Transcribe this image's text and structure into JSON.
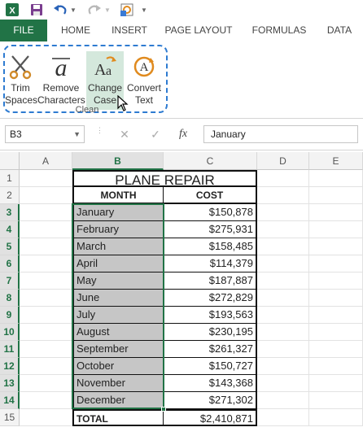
{
  "tabs": [
    {
      "label": "FILE",
      "active": true
    },
    {
      "label": "HOME"
    },
    {
      "label": "INSERT"
    },
    {
      "label": "PAGE LAYOUT"
    },
    {
      "label": "FORMULAS"
    },
    {
      "label": "DATA"
    }
  ],
  "ribbon": {
    "buttons": [
      {
        "line1": "Trim",
        "line2": "Spaces",
        "icon": "scissors-icon"
      },
      {
        "line1": "Remove",
        "line2": "Characters",
        "icon": "remove-characters-icon"
      },
      {
        "line1": "Change",
        "line2": "Case",
        "icon": "change-case-icon",
        "active": true
      },
      {
        "line1": "Convert",
        "line2": "Text",
        "icon": "convert-text-icon"
      }
    ],
    "group_label": "Clean"
  },
  "formula_bar": {
    "name_box": "B3",
    "fx": "fx",
    "value": "January"
  },
  "columns": [
    "A",
    "B",
    "C",
    "D",
    "E"
  ],
  "selected_column": "B",
  "rows": [
    "1",
    "2",
    "3",
    "4",
    "5",
    "6",
    "7",
    "8",
    "9",
    "10",
    "11",
    "12",
    "13",
    "14",
    "15"
  ],
  "sheet": {
    "title": "PLANE REPAIR",
    "headers": {
      "month": "MONTH",
      "cost": "COST"
    },
    "records": [
      {
        "month": "January",
        "cost": "$150,878"
      },
      {
        "month": "February",
        "cost": "$275,931"
      },
      {
        "month": "March",
        "cost": "$158,485"
      },
      {
        "month": "April",
        "cost": "$114,379"
      },
      {
        "month": "May",
        "cost": "$187,887"
      },
      {
        "month": "June",
        "cost": "$272,829"
      },
      {
        "month": "July",
        "cost": "$193,563"
      },
      {
        "month": "August",
        "cost": "$230,195"
      },
      {
        "month": "September",
        "cost": "$261,327"
      },
      {
        "month": "October",
        "cost": "$150,727"
      },
      {
        "month": "November",
        "cost": "$143,368"
      },
      {
        "month": "December",
        "cost": "$271,302"
      }
    ],
    "total": {
      "label": "TOTAL",
      "value": "$2,410,871"
    }
  },
  "colors": {
    "excel_green": "#217346",
    "selection_fill": "#c6c6c6",
    "highlight_border": "#2e7bd1"
  }
}
